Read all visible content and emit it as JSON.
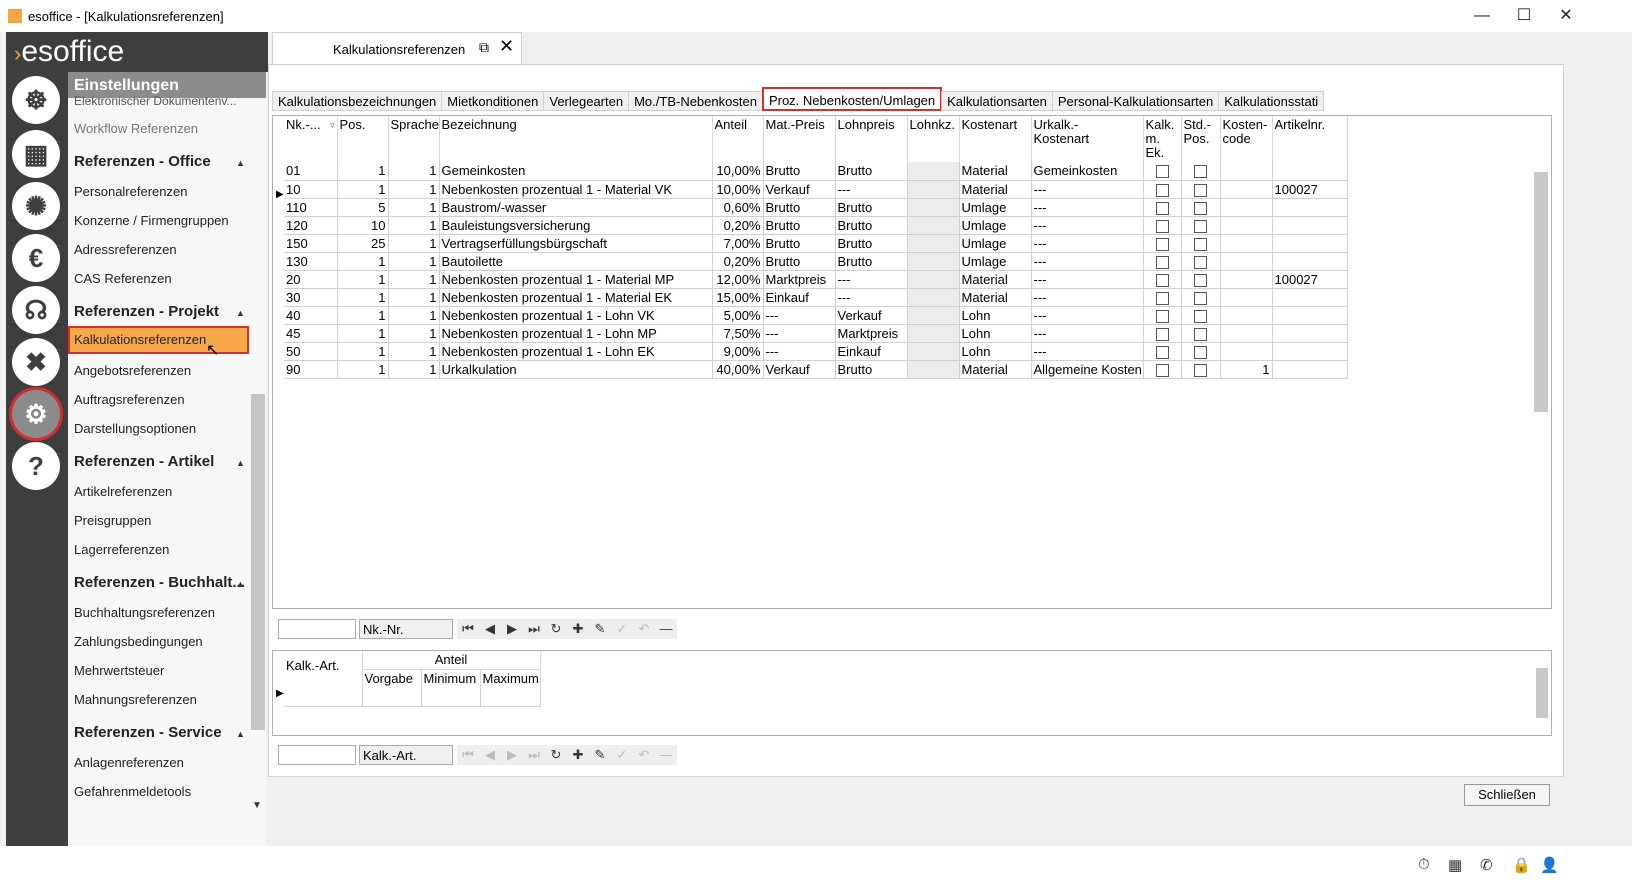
{
  "window": {
    "title": "esoffice - [Kalkulationsreferenzen]",
    "minimize": "—",
    "maximize": "☐",
    "close": "✕"
  },
  "brand": {
    "chevron": "›",
    "name": "esoffice"
  },
  "navrail": [
    {
      "icon": "helm-icon",
      "glyph": "☸"
    },
    {
      "icon": "calendar-icon",
      "glyph": "▦"
    },
    {
      "icon": "alarm-light-icon",
      "glyph": "✺"
    },
    {
      "icon": "euro-icon",
      "glyph": "€"
    },
    {
      "icon": "headset-icon",
      "glyph": "☊"
    },
    {
      "icon": "tools-icon",
      "glyph": "✖"
    },
    {
      "icon": "gears-icon",
      "glyph": "⚙"
    },
    {
      "icon": "help-icon",
      "glyph": "?"
    }
  ],
  "sidebar": {
    "header": "Einstellungen",
    "cut_item": "Elektronischer Dokumentenv...",
    "items": [
      {
        "type": "item",
        "label": "Workflow Referenzen",
        "dim": true
      },
      {
        "type": "section",
        "label": "Referenzen - Office"
      },
      {
        "type": "item",
        "label": "Personalreferenzen"
      },
      {
        "type": "item",
        "label": "Konzerne / Firmengruppen"
      },
      {
        "type": "item",
        "label": "Adressreferenzen"
      },
      {
        "type": "item",
        "label": "CAS Referenzen"
      },
      {
        "type": "section",
        "label": "Referenzen - Projekt"
      },
      {
        "type": "item",
        "label": "Kalkulationsreferenzen",
        "selected": true
      },
      {
        "type": "item",
        "label": "Angebotsreferenzen"
      },
      {
        "type": "item",
        "label": "Auftragsreferenzen"
      },
      {
        "type": "item",
        "label": "Darstellungsoptionen"
      },
      {
        "type": "section",
        "label": "Referenzen - Artikel"
      },
      {
        "type": "item",
        "label": "Artikelreferenzen"
      },
      {
        "type": "item",
        "label": "Preisgruppen"
      },
      {
        "type": "item",
        "label": "Lagerreferenzen"
      },
      {
        "type": "section",
        "label": "Referenzen - Buchhalt..."
      },
      {
        "type": "item",
        "label": "Buchhaltungsreferenzen"
      },
      {
        "type": "item",
        "label": "Zahlungsbedingungen"
      },
      {
        "type": "item",
        "label": "Mehrwertsteuer"
      },
      {
        "type": "item",
        "label": "Mahnungsreferenzen"
      },
      {
        "type": "section",
        "label": "Referenzen - Service"
      },
      {
        "type": "item",
        "label": "Anlagenreferenzen"
      },
      {
        "type": "item",
        "label": "Gefahrenmeldetools"
      }
    ]
  },
  "doctab": {
    "label": "Kalkulationsreferenzen",
    "popout": "⧉",
    "close": "✕"
  },
  "tabs": [
    {
      "label": "Kalkulationsbezeichnungen"
    },
    {
      "label": "Mietkonditionen"
    },
    {
      "label": "Verlegearten"
    },
    {
      "label": "Mo./TB-Nebenkosten"
    },
    {
      "label": "Proz. Nebenkosten/Umlagen",
      "active": true
    },
    {
      "label": "Kalkulationsarten"
    },
    {
      "label": "Personal-Kalkulationsarten"
    },
    {
      "label": "Kalkulationsstati"
    }
  ],
  "grid1": {
    "columns": [
      "Nk.-...",
      "Pos.",
      "Sprache",
      "Bezeichnung",
      "Anteil",
      "Mat.-Preis",
      "Lohnpreis",
      "Lohnkz.",
      "Kostenart",
      "Urkalk.-\nKostenart",
      "Kalk.\nm. Ek.",
      "Std.-\nPos.",
      "Kosten-\ncode",
      "Artikelnr."
    ],
    "rows": [
      [
        "01",
        "1",
        "1",
        "Gemeinkosten",
        "10,00%",
        "Brutto",
        "Brutto",
        "",
        "Material",
        "Gemeinkosten",
        "",
        "",
        "",
        ""
      ],
      [
        "10",
        "1",
        "1",
        "Nebenkosten prozentual 1 - Material VK",
        "10,00%",
        "Verkauf",
        "---",
        "",
        "Material",
        "---",
        "",
        "",
        "",
        "100027"
      ],
      [
        "110",
        "5",
        "1",
        "Baustrom/-wasser",
        "0,60%",
        "Brutto",
        "Brutto",
        "",
        "Umlage",
        "---",
        "",
        "",
        "",
        ""
      ],
      [
        "120",
        "10",
        "1",
        "Bauleistungsversicherung",
        "0,20%",
        "Brutto",
        "Brutto",
        "",
        "Umlage",
        "---",
        "",
        "",
        "",
        ""
      ],
      [
        "150",
        "25",
        "1",
        "Vertragserfüllungsbürgschaft",
        "7,00%",
        "Brutto",
        "Brutto",
        "",
        "Umlage",
        "---",
        "",
        "",
        "",
        ""
      ],
      [
        "130",
        "1",
        "1",
        "Bautoilette",
        "0,20%",
        "Brutto",
        "Brutto",
        "",
        "Umlage",
        "---",
        "",
        "",
        "",
        ""
      ],
      [
        "20",
        "1",
        "1",
        "Nebenkosten prozentual 1 - Material MP",
        "12,00%",
        "Marktpreis",
        "---",
        "",
        "Material",
        "---",
        "",
        "",
        "",
        "100027"
      ],
      [
        "30",
        "1",
        "1",
        "Nebenkosten prozentual 1 - Material EK",
        "15,00%",
        "Einkauf",
        "---",
        "",
        "Material",
        "---",
        "",
        "",
        "",
        ""
      ],
      [
        "40",
        "1",
        "1",
        "Nebenkosten prozentual 1 - Lohn VK",
        "5,00%",
        "---",
        "Verkauf",
        "",
        "Lohn",
        "---",
        "",
        "",
        "",
        ""
      ],
      [
        "45",
        "1",
        "1",
        "Nebenkosten prozentual 1 - Lohn MP",
        "7,50%",
        "---",
        "Marktpreis",
        "",
        "Lohn",
        "---",
        "",
        "",
        "",
        ""
      ],
      [
        "50",
        "1",
        "1",
        "Nebenkosten prozentual 1 - Lohn EK",
        "9,00%",
        "---",
        "Einkauf",
        "",
        "Lohn",
        "---",
        "",
        "",
        "",
        ""
      ],
      [
        "90",
        "1",
        "1",
        "Urkalkulation",
        "40,00%",
        "Verkauf",
        "Brutto",
        "",
        "Material",
        "Allgemeine Kosten",
        "",
        "",
        "1",
        ""
      ]
    ],
    "current_row": 2
  },
  "nav1": {
    "label": "Nk.-Nr."
  },
  "grid2": {
    "col1": "Kalk.-Art.",
    "group": "Anteil",
    "sub": [
      "Vorgabe",
      "Minimum",
      "Maximum"
    ]
  },
  "nav2": {
    "label": "Kalk.-Art."
  },
  "footer": {
    "close_label": "Schließen"
  },
  "status_icons": [
    "stopwatch-icon",
    "grid-icon",
    "phone-icon",
    "lock-icon",
    "user-icon"
  ]
}
